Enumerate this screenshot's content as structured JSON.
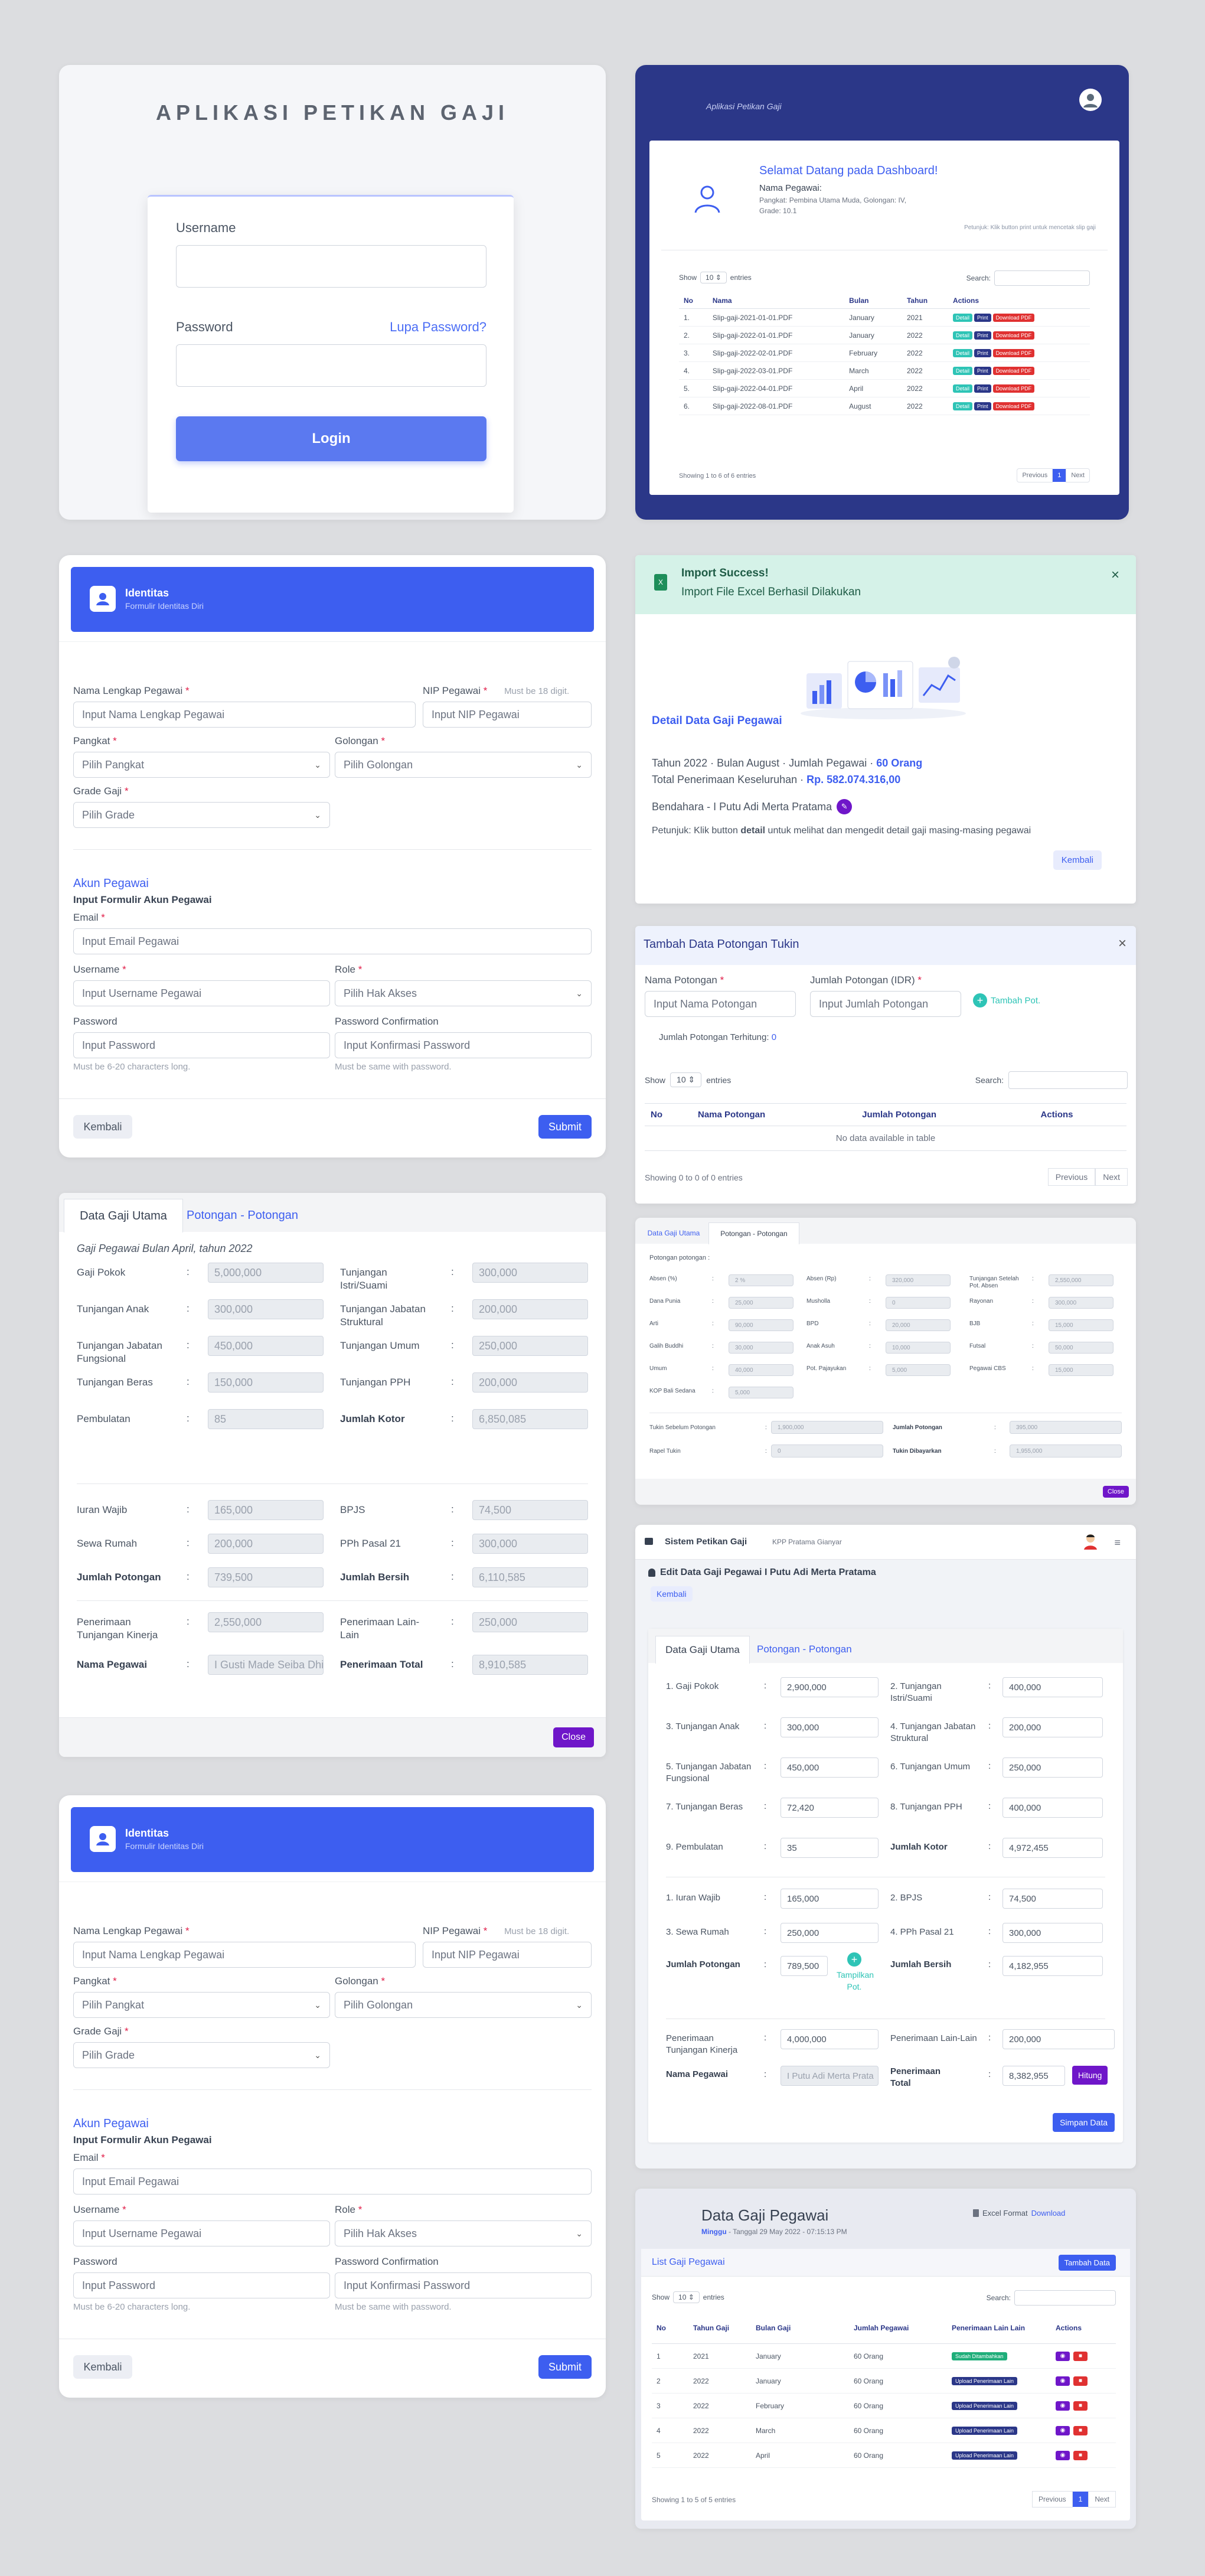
{
  "login": {
    "title": "APLIKASI PETIKAN GAJI",
    "username_label": "Username",
    "password_label": "Password",
    "forgot_label": "Lupa Password?",
    "login_button": "Login"
  },
  "dashboard": {
    "header_title": "Aplikasi Petikan Gaji",
    "welcome": "Selamat Datang pada Dashboard!",
    "nama_label": "Nama Pegawai:",
    "pangkat_line": "Pangkat: Pembina Utama Muda, Golongan: IV,",
    "grade_line": "Grade: 10.1",
    "hint": "Petunjuk: Klik button print untuk mencetak slip gaji",
    "show_label": "Show",
    "show_value": "10",
    "entries_label": "entries",
    "search_label": "Search:",
    "columns": [
      "No",
      "Nama",
      "Bulan",
      "Tahun",
      "Actions"
    ],
    "rows": [
      {
        "no": "1.",
        "nama": "Slip-gaji-2021-01-01.PDF",
        "bulan": "January",
        "tahun": "2021"
      },
      {
        "no": "2.",
        "nama": "Slip-gaji-2022-01-01.PDF",
        "bulan": "January",
        "tahun": "2022"
      },
      {
        "no": "3.",
        "nama": "Slip-gaji-2022-02-01.PDF",
        "bulan": "February",
        "tahun": "2022"
      },
      {
        "no": "4.",
        "nama": "Slip-gaji-2022-03-01.PDF",
        "bulan": "March",
        "tahun": "2022"
      },
      {
        "no": "5.",
        "nama": "Slip-gaji-2022-04-01.PDF",
        "bulan": "April",
        "tahun": "2022"
      },
      {
        "no": "6.",
        "nama": "Slip-gaji-2022-08-01.PDF",
        "bulan": "August",
        "tahun": "2022"
      }
    ],
    "btn_detail": "Detail",
    "btn_print": "Print",
    "btn_pdf": "Download PDF",
    "showing": "Showing 1 to 6 of 6 entries",
    "prev": "Previous",
    "page": "1",
    "next": "Next"
  },
  "identitas": {
    "head_title": "Identitas",
    "head_sub": "Formulir Identitas Diri",
    "nama_label": "Nama Lengkap Pegawai",
    "nama_ph": "Input Nama Lengkap Pegawai",
    "nip_label": "NIP Pegawai",
    "nip_hint": "Must be 18 digit.",
    "nip_ph": "Input NIP Pegawai",
    "pangkat_label": "Pangkat",
    "pangkat_ph": "Pilih Pangkat",
    "golongan_label": "Golongan",
    "golongan_ph": "Pilih Golongan",
    "grade_label": "Grade Gaji",
    "grade_ph": "Pilih Grade",
    "akun_title": "Akun Pegawai",
    "akun_sub": "Input Formulir Akun Pegawai",
    "email_label": "Email",
    "email_ph": "Input Email Pegawai",
    "username_label": "Username",
    "username_ph": "Input Username Pegawai",
    "role_label": "Role",
    "role_ph": "Pilih Hak Akses",
    "password_label": "Password",
    "password_ph": "Input Password",
    "password_hint": "Must be 6-20 characters long.",
    "confirm_label": "Password Confirmation",
    "confirm_ph": "Input Konfirmasi Password",
    "confirm_hint": "Must be same with password.",
    "kembali": "Kembali",
    "submit": "Submit"
  },
  "import": {
    "alert_title": "Import Success!",
    "alert_msg": "Import File Excel Berhasil Dilakukan",
    "close": "×",
    "title": "Detail Data Gaji Pegawai",
    "line1_a": "Tahun 2022 ·  Bulan August · Jumlah Pegawai · ",
    "line1_b": "60 Orang",
    "line2_a": "Total Penerimaan Keseluruhan · ",
    "line2_b": "Rp. 582.074.316,00",
    "bendahara": "Bendahara - I Putu Adi Merta Pratama",
    "hint_a": "Petunjuk: Klik button ",
    "hint_b": "detail",
    "hint_c": " untuk melihat dan mengedit detail gaji masing-masing pegawai",
    "kembali": "Kembali"
  },
  "potongan_modal": {
    "title": "Tambah Data Potongan Tukin",
    "close": "×",
    "nama_label": "Nama Potongan",
    "nama_ph": "Input Nama Potongan",
    "jumlah_label": "Jumlah Potongan (IDR)",
    "jumlah_ph": "Input Jumlah Potongan",
    "tambah": "Tambah Pot.",
    "terhitung_label": "Jumlah Potongan Terhitung:",
    "terhitung_value": "0",
    "show_label": "Show",
    "show_value": "10",
    "entries_label": "entries",
    "search_label": "Search:",
    "columns": [
      "No",
      "Nama Potongan",
      "Jumlah Potongan",
      "Actions"
    ],
    "empty": "No data available in table",
    "showing": "Showing 0 to 0 of 0 entries",
    "prev": "Previous",
    "next": "Next"
  },
  "gaji_view": {
    "tab1": "Data Gaji Utama",
    "tab2": "Potongan - Potongan",
    "subtitle": "Gaji Pegawai Bulan April, tahun 2022",
    "rows1": [
      {
        "l1": "Gaji Pokok",
        "v1": "5,000,000",
        "l2": "Tunjangan Istri/Suami",
        "v2": "300,000"
      },
      {
        "l1": "Tunjangan Anak",
        "v1": "300,000",
        "l2": "Tunjangan Jabatan Struktural",
        "v2": "200,000"
      },
      {
        "l1": "Tunjangan Jabatan Fungsional",
        "v1": "450,000",
        "l2": "Tunjangan Umum",
        "v2": "250,000"
      },
      {
        "l1": "Tunjangan Beras",
        "v1": "150,000",
        "l2": "Tunjangan PPH",
        "v2": "200,000"
      },
      {
        "l1": "Pembulatan",
        "v1": "85",
        "l2": "Jumlah Kotor",
        "v2": "6,850,085"
      }
    ],
    "rows2": [
      {
        "l1": "Iuran Wajib",
        "v1": "165,000",
        "l2": "BPJS",
        "v2": "74,500"
      },
      {
        "l1": "Sewa Rumah",
        "v1": "200,000",
        "l2": "PPh Pasal 21",
        "v2": "300,000"
      },
      {
        "l1": "Jumlah Potongan",
        "v1": "739,500",
        "l2": "Jumlah Bersih",
        "v2": "6,110,585"
      }
    ],
    "rows3": [
      {
        "l1": "Penerimaan Tunjangan Kinerja",
        "v1": "2,550,000",
        "l2": "Penerimaan Lain-Lain",
        "v2": "250,000"
      },
      {
        "l1": "Nama Pegawai",
        "v1": "I Gusti Made Seiba Dhi",
        "l2": "Penerimaan Total",
        "v2": "8,910,585"
      }
    ],
    "close": "Close"
  },
  "potongan_view": {
    "tab1": "Data Gaji Utama",
    "tab2": "Potongan - Potongan",
    "section": "Potongan potongan :",
    "cells": [
      [
        "Absen (%)",
        "2 %",
        "Absen (Rp)",
        "320,000",
        "Tunjangan Setelah Pot. Absen",
        "2,550,000"
      ],
      [
        "Dana Punia",
        "25,000",
        "Musholla",
        "0",
        "Rayonan",
        "300,000"
      ],
      [
        "Arti",
        "90,000",
        "BPD",
        "20,000",
        "BJB",
        "15,000"
      ],
      [
        "Galih Buddhi",
        "30,000",
        "Anak Asuh",
        "10,000",
        "Futsal",
        "50,000"
      ],
      [
        "Umum",
        "40,000",
        "Pot. Pajayukan",
        "5,000",
        "Pegawai CBS",
        "15,000"
      ],
      [
        "KOP Bali Sedana",
        "5,000",
        "",
        "",
        "",
        ""
      ]
    ],
    "tukin_sebelum_label": "Tukin Sebelum Potongan",
    "tukin_sebelum": "1,900,000",
    "jumlah_pot_label": "Jumlah Potongan",
    "jumlah_pot": "395,000",
    "rapel_label": "Rapel Tukin",
    "rapel": "0",
    "tukin_dibayar_label": "Tukin Dibayarkan",
    "tukin_dibayar": "1,955,000",
    "close": "Close"
  },
  "edit": {
    "brand": "Sistem Petikan Gaji",
    "office": "KPP Pratama Gianyar",
    "page_title": "Edit Data Gaji Pegawai I Putu Adi Merta Pratama",
    "kembali": "Kembali",
    "tab1": "Data Gaji Utama",
    "tab2": "Potongan - Potongan",
    "rows1": [
      {
        "l1": "1. Gaji Pokok",
        "v1": "2,900,000",
        "l2": "2. Tunjangan Istri/Suami",
        "v2": "400,000"
      },
      {
        "l1": "3. Tunjangan Anak",
        "v1": "300,000",
        "l2": "4. Tunjangan Jabatan Struktural",
        "v2": "200,000"
      },
      {
        "l1": "5. Tunjangan Jabatan Fungsional",
        "v1": "450,000",
        "l2": "6. Tunjangan Umum",
        "v2": "250,000"
      },
      {
        "l1": "7. Tunjangan Beras",
        "v1": "72,420",
        "l2": "8. Tunjangan PPH",
        "v2": "400,000"
      },
      {
        "l1": "9. Pembulatan",
        "v1": "35",
        "l2": "Jumlah Kotor",
        "v2": "4,972,455"
      }
    ],
    "rows2": [
      {
        "l1": "1. Iuran Wajib",
        "v1": "165,000",
        "l2": "2. BPJS",
        "v2": "74,500"
      },
      {
        "l1": "3. Sewa Rumah",
        "v1": "250,000",
        "l2": "4. PPh Pasal 21",
        "v2": "300,000"
      }
    ],
    "jumlah_potongan_label": "Jumlah Potongan",
    "jumlah_potongan": "789,500",
    "tampilkan": "Tampilkan Pot.",
    "jumlah_bersih_label": "Jumlah Bersih",
    "jumlah_bersih": "4,182,955",
    "tukin_label": "Penerimaan Tunjangan Kinerja",
    "tukin": "4,000,000",
    "lain_label": "Penerimaan Lain-Lain",
    "lain": "200,000",
    "nama_label": "Nama Pegawai",
    "nama": "I Putu Adi Merta Prata",
    "total_label": "Penerimaan Total",
    "total": "8,382,955",
    "hitung": "Hitung",
    "simpan": "Simpan Data"
  },
  "datagaji": {
    "title": "Data Gaji Pegawai",
    "excel_a": "Excel Format ",
    "excel_b": "Download",
    "day": "Minggu",
    "date": " - Tanggal 29 May 2022 - 07:15:13 PM",
    "list_title": "List Gaji Pegawai",
    "tambah": "Tambah Data",
    "show_label": "Show",
    "show_value": "10",
    "entries_label": "entries",
    "search_label": "Search:",
    "columns": [
      "No",
      "Tahun Gaji",
      "Bulan Gaji",
      "Jumlah Pegawai",
      "Penerimaan Lain Lain",
      "Actions"
    ],
    "rows": [
      {
        "no": "1",
        "tahun": "2021",
        "bulan": "January",
        "jumlah": "60 Orang",
        "status": "Sudah Ditambahkan",
        "done": true
      },
      {
        "no": "2",
        "tahun": "2022",
        "bulan": "January",
        "jumlah": "60 Orang",
        "status": "Upload Penerimaan Lain",
        "done": false
      },
      {
        "no": "3",
        "tahun": "2022",
        "bulan": "February",
        "jumlah": "60 Orang",
        "status": "Upload Penerimaan Lain",
        "done": false
      },
      {
        "no": "4",
        "tahun": "2022",
        "bulan": "March",
        "jumlah": "60 Orang",
        "status": "Upload Penerimaan Lain",
        "done": false
      },
      {
        "no": "5",
        "tahun": "2022",
        "bulan": "April",
        "jumlah": "60 Orang",
        "status": "Upload Penerimaan Lain",
        "done": false
      }
    ],
    "showing": "Showing 1 to 5 of 5 entries",
    "prev": "Previous",
    "page": "1",
    "next": "Next"
  },
  "colors": {
    "primary": "#3d5ef0",
    "navy": "#2b3788",
    "purple": "#6f16c9",
    "teal": "#2ec4b6",
    "red": "#e03131"
  }
}
